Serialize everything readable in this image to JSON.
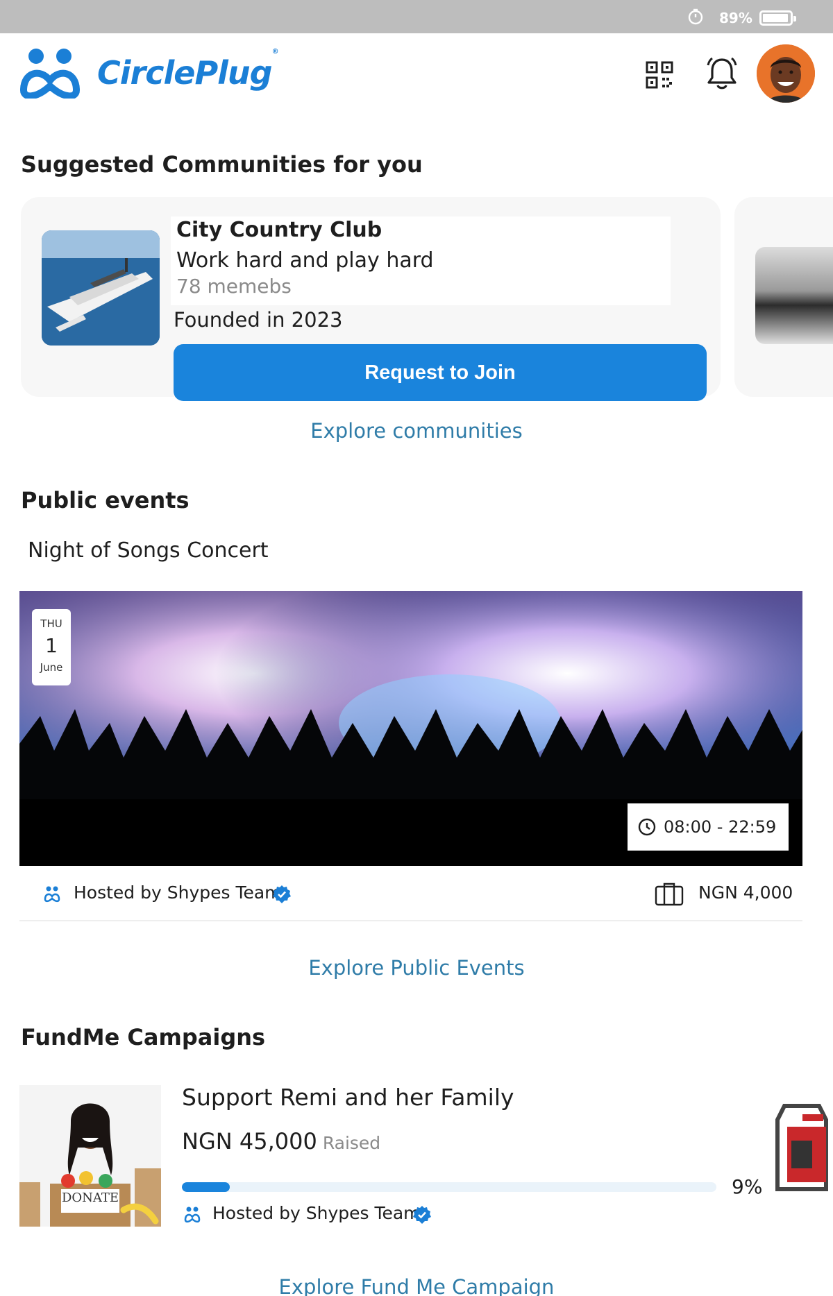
{
  "status_bar": {
    "battery_percent": "89%",
    "battery_level": 0.89
  },
  "app": {
    "name": "CirclePlug",
    "trademark": "®",
    "brand_color": "#1b7fd6",
    "icons": [
      "logo-mark-icon",
      "qr-code-icon",
      "bell-icon"
    ]
  },
  "suggested_communities": {
    "title": "Suggested Communities for you",
    "card": {
      "name": "City Country Club",
      "tagline": "Work hard and play hard",
      "members": "78 memebs",
      "founded": "Founded in 2023",
      "join_label": "Request to Join"
    },
    "explore_label": "Explore communities"
  },
  "public_events": {
    "title": "Public events",
    "event": {
      "name": "Night of Songs Concert",
      "day_of_week": "THU",
      "day": "1",
      "month": "June",
      "time": "08:00 - 22:59",
      "host": "Hosted by Shypes Team",
      "price": "NGN 4,000"
    },
    "explore_label": "Explore Public Events"
  },
  "fundme": {
    "title": "FundMe Campaigns",
    "campaign": {
      "title": "Support Remi and her Family",
      "raised_amount": "NGN 45,000",
      "raised_label": "Raised",
      "progress_percent": 9,
      "progress_label": "9%",
      "host": "Hosted by Shypes Team",
      "sign_text": "DONATE"
    },
    "explore_label": "Explore Fund Me Campaign"
  }
}
